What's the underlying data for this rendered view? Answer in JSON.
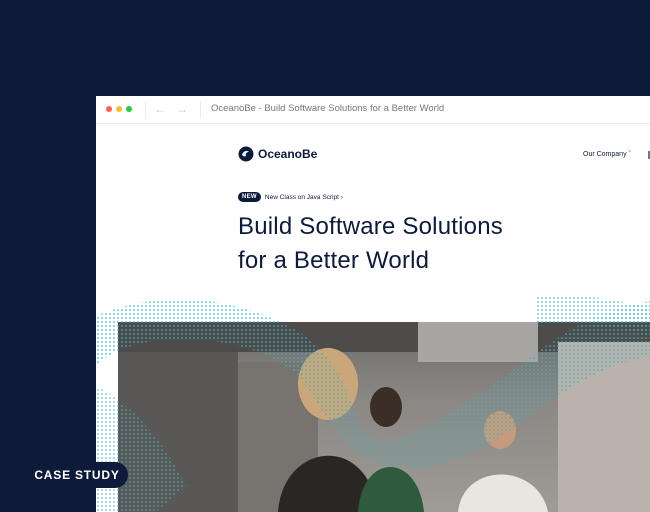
{
  "browser": {
    "title": "OceanoBe - Build Software Solutions for a Better World",
    "back_icon": "arrow-left-icon",
    "forward_icon": "arrow-right-icon"
  },
  "site": {
    "logo_text": "OceanoBe",
    "logo_icon": "oceanobe-logo-icon",
    "menu_item": "Our Company",
    "menu_chevron": "chevron-down-icon"
  },
  "hero": {
    "badge": "NEW",
    "badge_link": "New Class on Java Script ›",
    "headline_line1": "Build Software Solutions",
    "headline_line2": "for a Better World"
  },
  "overlay": {
    "case_study_label": "CASE STUDY"
  },
  "colors": {
    "navy": "#0d1a3a",
    "teal_dots": "#3bb3c3",
    "white": "#ffffff"
  }
}
